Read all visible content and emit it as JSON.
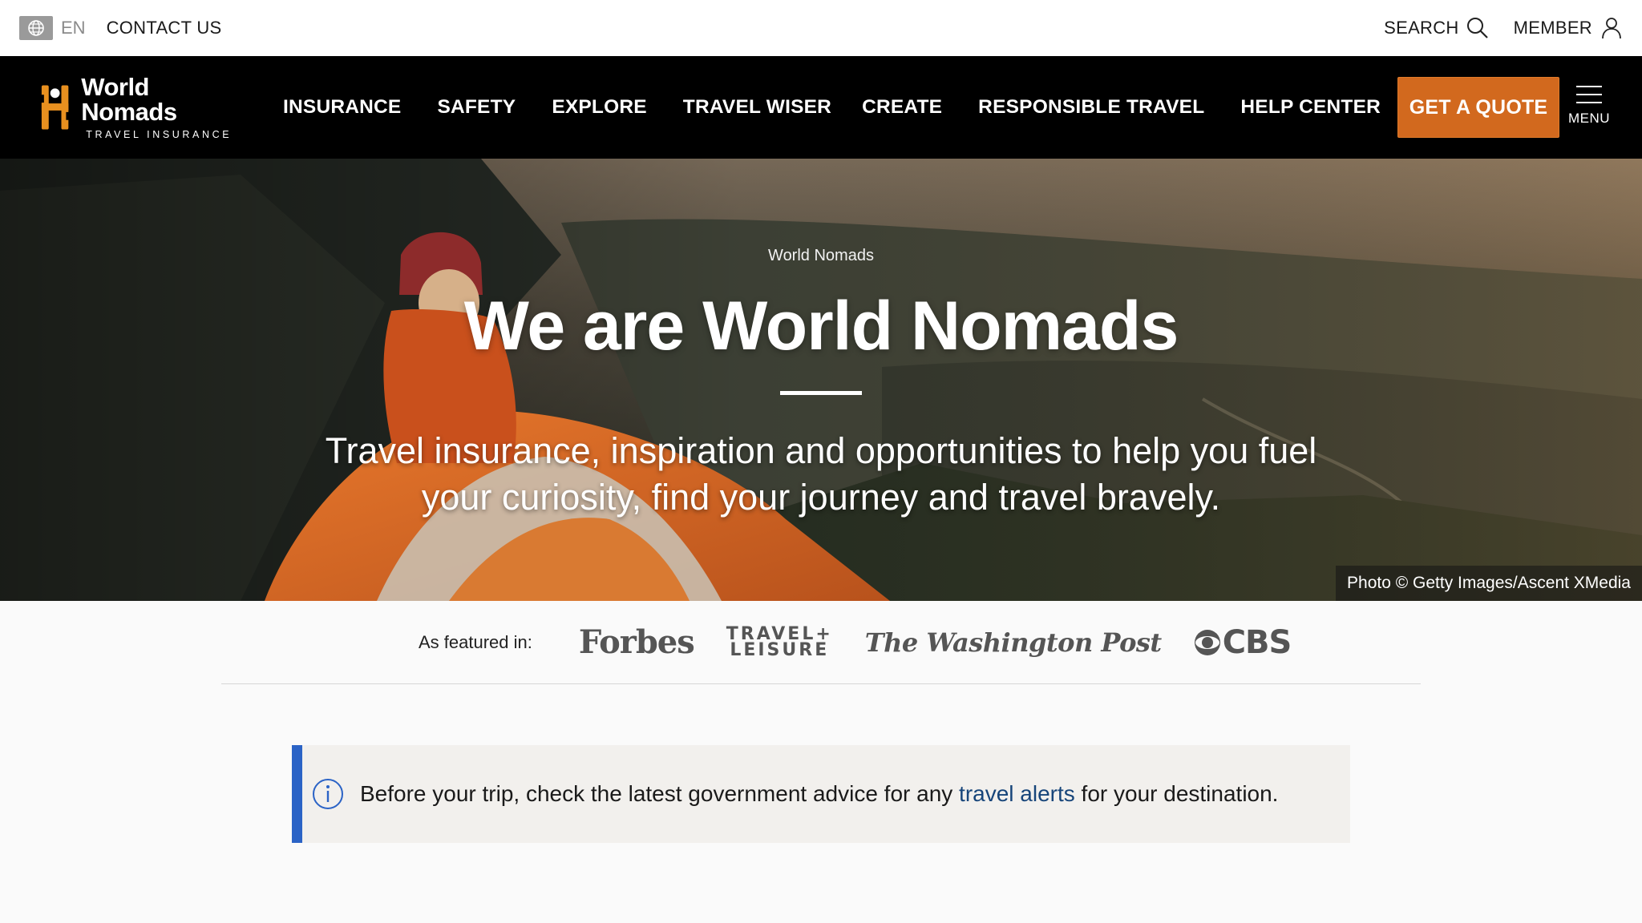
{
  "utility": {
    "language": "EN",
    "contact_label": "CONTACT US",
    "search_label": "SEARCH",
    "member_label": "MEMBER"
  },
  "brand": {
    "name": "World Nomads",
    "tagline": "TRAVEL INSURANCE",
    "accent_color": "#d2691e"
  },
  "nav": {
    "items": [
      {
        "label": "INSURANCE"
      },
      {
        "label": "SAFETY"
      },
      {
        "label": "EXPLORE"
      },
      {
        "label": "TRAVEL WISER"
      },
      {
        "label": "CREATE"
      },
      {
        "label": "RESPONSIBLE TRAVEL"
      },
      {
        "label": "HELP CENTER"
      }
    ],
    "cta_label": "GET A QUOTE",
    "menu_label": "MENU"
  },
  "hero": {
    "eyebrow": "World Nomads",
    "title": "We are World Nomads",
    "subtitle": "Travel insurance, inspiration and opportunities to help you fuel your curiosity, find your journey and travel bravely.",
    "photo_credit": "Photo © Getty Images/Ascent XMedia"
  },
  "featured": {
    "label": "As featured in:",
    "logos": {
      "forbes": "Forbes",
      "tl_line1": "TRAVEL+",
      "tl_line2": "LEISURE",
      "wapo": "The Washington Post",
      "cbs": "CBS"
    }
  },
  "alert": {
    "text_before": "Before your trip, check the latest government advice for any ",
    "link_text": "travel alerts",
    "text_after": " for your destination.",
    "border_color": "#2b63c6"
  }
}
